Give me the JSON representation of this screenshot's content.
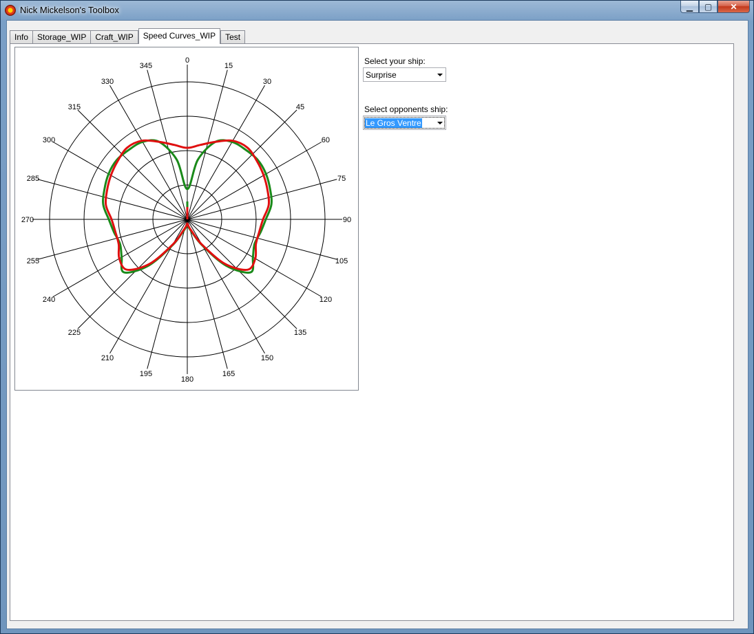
{
  "window": {
    "title": "Nick Mickelson's Toolbox",
    "minimize_glyph": "▁",
    "maximize_glyph": "▢",
    "close_glyph": "✕",
    "icon": "app-logo-icon"
  },
  "tabs": [
    {
      "label": "Info",
      "active": false
    },
    {
      "label": "Storage_WIP",
      "active": false
    },
    {
      "label": "Craft_WIP",
      "active": false
    },
    {
      "label": "Speed Curves_WIP",
      "active": true
    },
    {
      "label": "Test",
      "active": false
    }
  ],
  "your_ship": {
    "label": "Select your ship:",
    "value": "Surprise"
  },
  "opponent_ship": {
    "label": "Select opponents ship:",
    "value": "Le Gros Ventre"
  },
  "chart_data": {
    "type": "polar",
    "angle_labels": [
      "0",
      "15",
      "30",
      "45",
      "60",
      "75",
      "90",
      "105",
      "120",
      "135",
      "150",
      "165",
      "180",
      "195",
      "210",
      "225",
      "240",
      "255",
      "270",
      "285",
      "300",
      "315",
      "330",
      "345"
    ],
    "radial_rings": 4,
    "grid": true,
    "colors": {
      "green": "#1a8a1a",
      "red": "#e01010"
    },
    "series": [
      {
        "color": "green",
        "angles": [
          0,
          10,
          20,
          30,
          40,
          50,
          60,
          70,
          80,
          90,
          100,
          110,
          120,
          130,
          140,
          150,
          160,
          170,
          180
        ],
        "radii": [
          0.22,
          0.44,
          0.6,
          0.65,
          0.66,
          0.67,
          0.66,
          0.64,
          0.62,
          0.57,
          0.54,
          0.52,
          0.55,
          0.6,
          0.44,
          0.22,
          0.1,
          0.06,
          0.04
        ]
      },
      {
        "color": "red",
        "angles": [
          0,
          10,
          20,
          30,
          40,
          50,
          60,
          70,
          80,
          90,
          100,
          110,
          120,
          130,
          140,
          150,
          160,
          170,
          180
        ],
        "radii": [
          0.52,
          0.55,
          0.6,
          0.66,
          0.68,
          0.66,
          0.64,
          0.62,
          0.6,
          0.55,
          0.53,
          0.53,
          0.57,
          0.57,
          0.42,
          0.21,
          0.09,
          0.05,
          0.03
        ]
      }
    ]
  }
}
